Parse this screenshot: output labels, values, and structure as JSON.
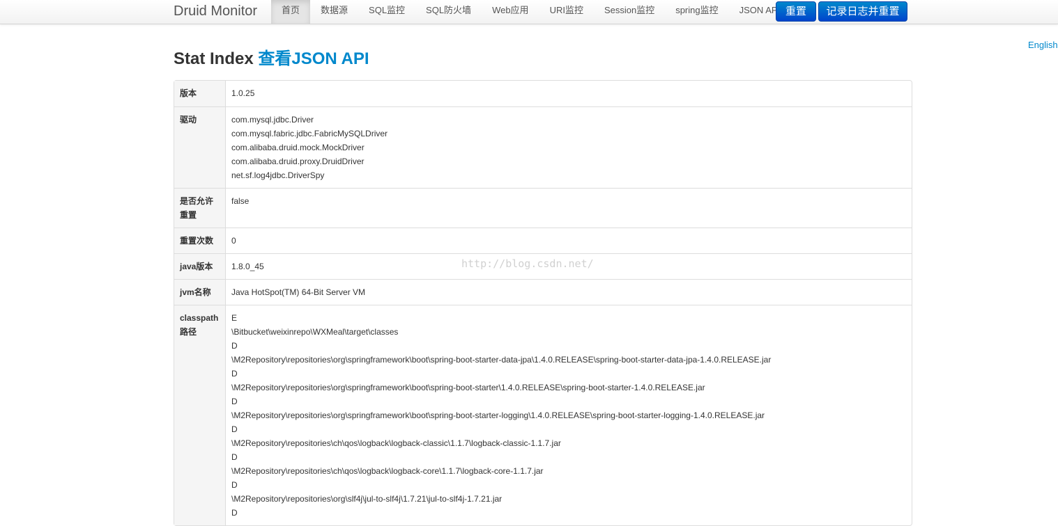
{
  "navbar": {
    "brand": "Druid Monitor",
    "items": [
      {
        "label": "首页",
        "active": true
      },
      {
        "label": "数据源"
      },
      {
        "label": "SQL监控"
      },
      {
        "label": "SQL防火墙"
      },
      {
        "label": "Web应用"
      },
      {
        "label": "URI监控"
      },
      {
        "label": "Session监控"
      },
      {
        "label": "spring监控"
      },
      {
        "label": "JSON API"
      }
    ],
    "reset_label": "重置",
    "log_reset_label": "记录日志并重置"
  },
  "language_link": "English",
  "page": {
    "title": "Stat Index",
    "title_link": "查看JSON API"
  },
  "watermark": "http://blog.csdn.net/",
  "stats": {
    "version": {
      "label": "版本",
      "value": "1.0.25"
    },
    "drivers": {
      "label": "驱动",
      "values": [
        "com.mysql.jdbc.Driver",
        "com.mysql.fabric.jdbc.FabricMySQLDriver",
        "com.alibaba.druid.mock.MockDriver",
        "com.alibaba.druid.proxy.DruidDriver",
        "net.sf.log4jdbc.DriverSpy"
      ]
    },
    "reset_enable": {
      "label": "是否允许重置",
      "value": "false"
    },
    "reset_count": {
      "label": "重置次数",
      "value": "0"
    },
    "java_version": {
      "label": "java版本",
      "value": "1.8.0_45"
    },
    "jvm_name": {
      "label": "jvm名称",
      "value": "Java HotSpot(TM) 64-Bit Server VM"
    },
    "classpath": {
      "label": "classpath路径",
      "values": [
        "E",
        "\\Bitbucket\\weixinrepo\\WXMeal\\target\\classes",
        "D",
        "\\M2Repository\\repositories\\org\\springframework\\boot\\spring-boot-starter-data-jpa\\1.4.0.RELEASE\\spring-boot-starter-data-jpa-1.4.0.RELEASE.jar",
        "D",
        "\\M2Repository\\repositories\\org\\springframework\\boot\\spring-boot-starter\\1.4.0.RELEASE\\spring-boot-starter-1.4.0.RELEASE.jar",
        "D",
        "\\M2Repository\\repositories\\org\\springframework\\boot\\spring-boot-starter-logging\\1.4.0.RELEASE\\spring-boot-starter-logging-1.4.0.RELEASE.jar",
        "D",
        "\\M2Repository\\repositories\\ch\\qos\\logback\\logback-classic\\1.1.7\\logback-classic-1.1.7.jar",
        "D",
        "\\M2Repository\\repositories\\ch\\qos\\logback\\logback-core\\1.1.7\\logback-core-1.1.7.jar",
        "D",
        "\\M2Repository\\repositories\\org\\slf4j\\jul-to-slf4j\\1.7.21\\jul-to-slf4j-1.7.21.jar",
        "D"
      ]
    }
  }
}
